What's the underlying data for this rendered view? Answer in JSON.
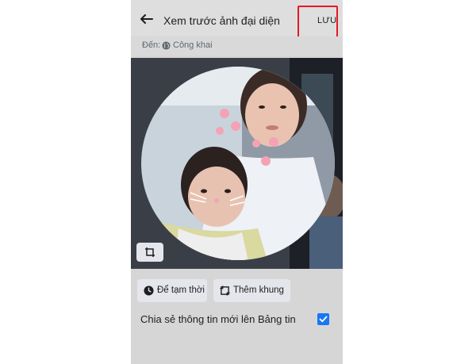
{
  "header": {
    "title": "Xem trước ảnh đại diện",
    "save_label": "LƯU"
  },
  "audience": {
    "label": "Đến:",
    "value": "Công khai"
  },
  "actions": {
    "temporary_label": "Để tạm thời",
    "frame_label": "Thêm khung"
  },
  "share": {
    "label": "Chia sẻ thông tin mới lên Bảng tin",
    "checked": true
  },
  "colors": {
    "accent": "#1877f2",
    "highlight": "#e21b23"
  }
}
